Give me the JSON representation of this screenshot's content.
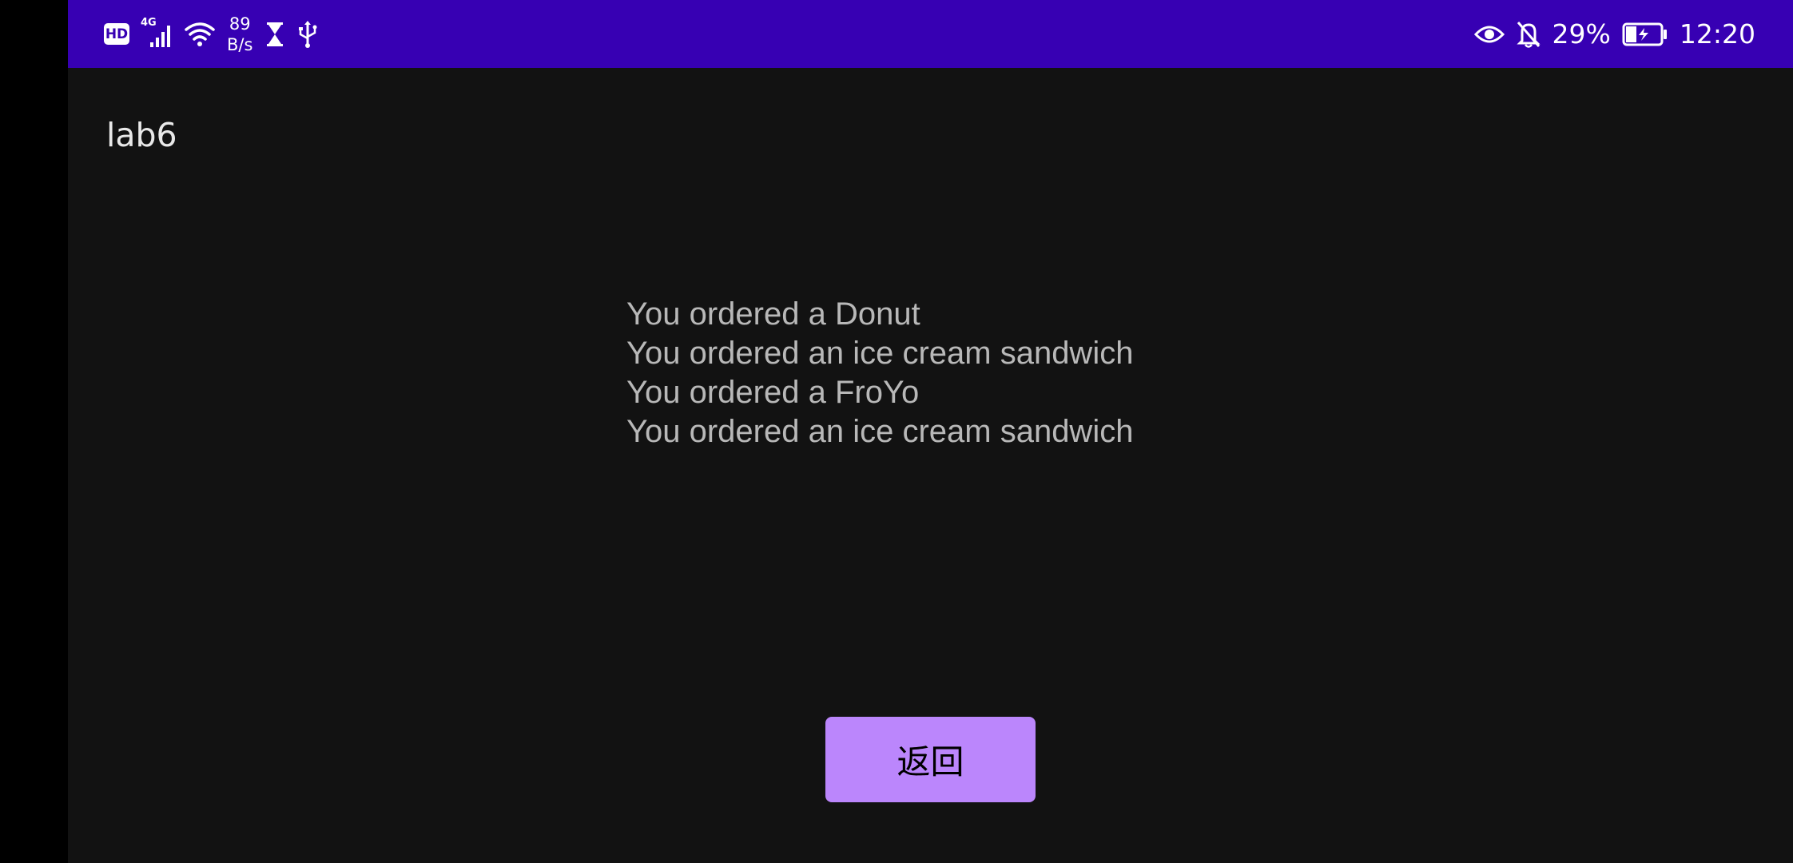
{
  "status_bar": {
    "hd_badge": "HD",
    "network_type": "4G",
    "net_speed_value": "89",
    "net_speed_unit": "B/s",
    "battery_percent": "29%",
    "time": "12:20",
    "left_icons": [
      "hd-icon",
      "signal-4g-icon",
      "wifi-icon",
      "hourglass-icon",
      "usb-icon"
    ],
    "right_icons": [
      "eye-icon",
      "bell-off-icon",
      "battery-charging-icon"
    ],
    "background_color": "#3700b3"
  },
  "app": {
    "title": "lab6",
    "background_color": "#121212",
    "orders": [
      "You ordered a Donut",
      "You ordered an ice cream sandwich",
      "You ordered a FroYo",
      "You ordered an ice cream sandwich"
    ],
    "back_button_label": "返回",
    "accent_color": "#bb86fc"
  }
}
